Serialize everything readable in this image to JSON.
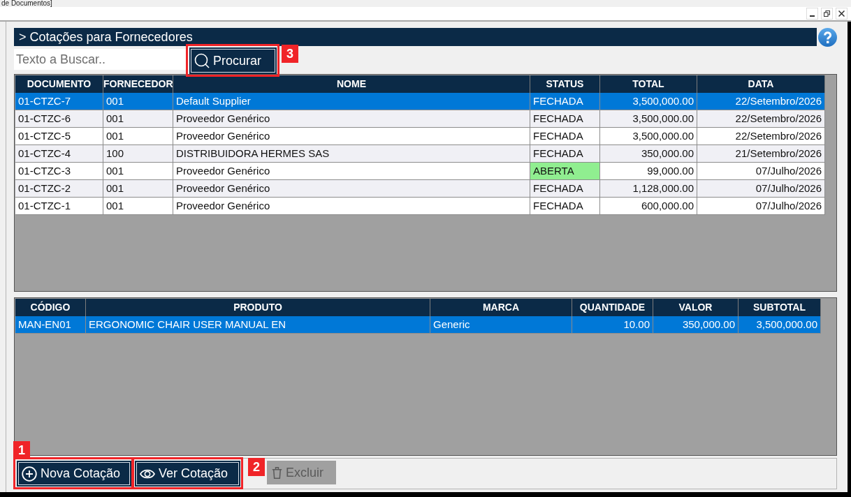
{
  "window": {
    "title": "de Documentos]"
  },
  "page": {
    "title": "> Cotações para Fornecedores"
  },
  "search": {
    "placeholder": "Texto a Buscar..",
    "button": {
      "label": "Procurar",
      "kind": "search",
      "disabled": false,
      "callout": "3"
    }
  },
  "quotes_table": {
    "columns": [
      "DOCUMENTO",
      "FORNECEDOR",
      "NOME",
      "STATUS",
      "TOTAL",
      "DATA"
    ],
    "rows": [
      {
        "cells": [
          "01-CTZC-7",
          "001",
          "Default Supplier",
          "FECHADA",
          "3,500,000.00",
          "22/Setembro/2026"
        ],
        "selected": true
      },
      {
        "cells": [
          "01-CTZC-6",
          "001",
          "Proveedor Genérico",
          "FECHADA",
          "3,500,000.00",
          "22/Setembro/2026"
        ],
        "selected": false
      },
      {
        "cells": [
          "01-CTZC-5",
          "001",
          "Proveedor Genérico",
          "FECHADA",
          "3,500,000.00",
          "22/Setembro/2026"
        ],
        "selected": false
      },
      {
        "cells": [
          "01-CTZC-4",
          "100",
          "DISTRIBUIDORA HERMES SAS",
          "FECHADA",
          "350,000.00",
          "21/Setembro/2026"
        ],
        "selected": false
      },
      {
        "cells": [
          "01-CTZC-3",
          "001",
          "Proveedor Genérico",
          "ABERTA",
          "99,000.00",
          "07/Julho/2026"
        ],
        "selected": false,
        "color": "#90ee90"
      },
      {
        "cells": [
          "01-CTZC-2",
          "001",
          "Proveedor Genérico",
          "FECHADA",
          "1,128,000.00",
          "07/Julho/2026"
        ],
        "selected": false
      },
      {
        "cells": [
          "01-CTZC-1",
          "001",
          "Proveedor Genérico",
          "FECHADA",
          "600,000.00",
          "07/Julho/2026"
        ],
        "selected": false
      }
    ]
  },
  "items_table": {
    "columns": [
      "CÓDIGO",
      "PRODUTO",
      "MARCA",
      "QUANTIDADE",
      "VALOR",
      "SUBTOTAL"
    ],
    "rows": [
      {
        "cells": [
          "MAN-EN01",
          "ERGONOMIC CHAIR USER MANUAL EN",
          "Generic",
          "10.00",
          "350,000.00",
          "3,500,000.00"
        ],
        "selected": true
      }
    ]
  },
  "actions": [
    {
      "label": "Nova Cotação",
      "kind": "new",
      "disabled": false,
      "callout": "1"
    },
    {
      "label": "Ver Cotação",
      "kind": "view",
      "disabled": false,
      "callout": "2"
    },
    {
      "label": "Excluir",
      "kind": "delete",
      "disabled": true
    }
  ]
}
